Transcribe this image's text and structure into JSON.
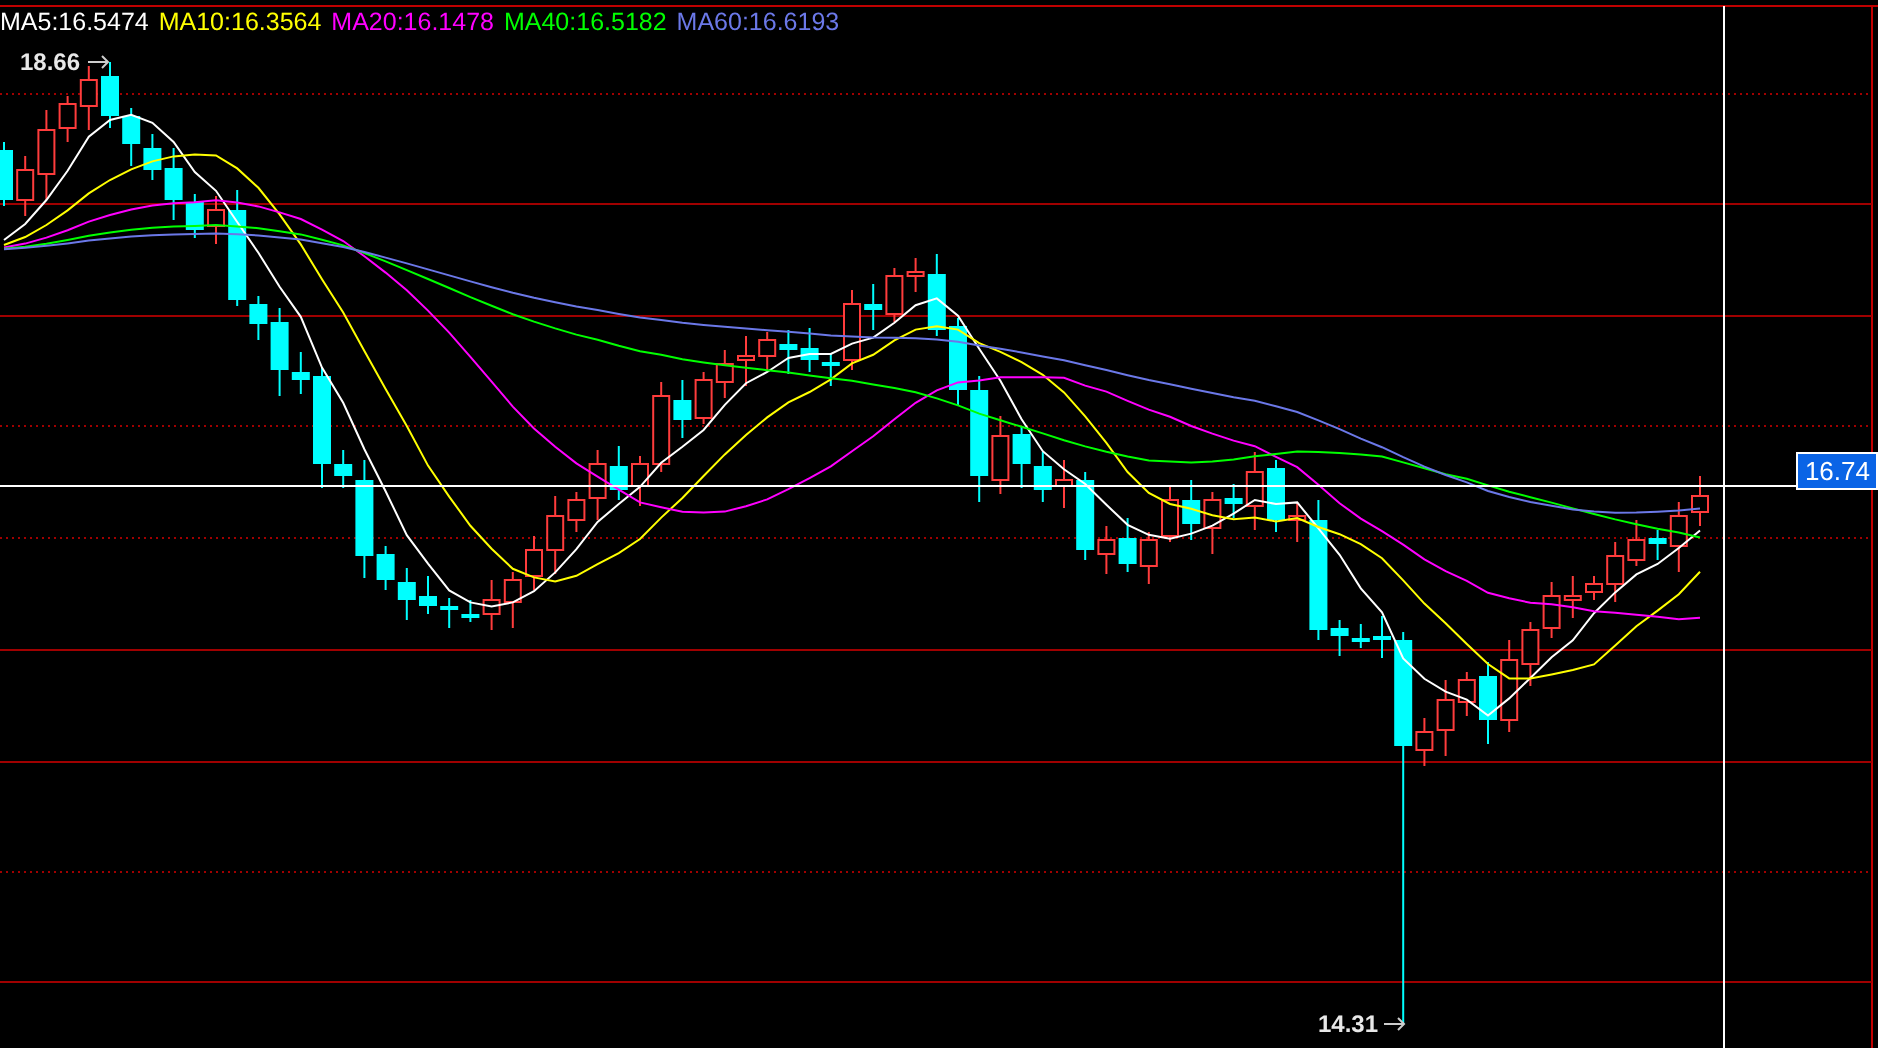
{
  "legend": [
    {
      "label": "MA5:16.5474",
      "color": "#ffffff"
    },
    {
      "label": "MA10:16.3564",
      "color": "#ffff00"
    },
    {
      "label": "MA20:16.1478",
      "color": "#ff00ff"
    },
    {
      "label": "MA40:16.5182",
      "color": "#00ff00"
    },
    {
      "label": "MA60:16.6193",
      "color": "#6b78e8"
    }
  ],
  "high_label": "18.66",
  "low_label": "14.31",
  "crosshair_price": "16.74"
}
